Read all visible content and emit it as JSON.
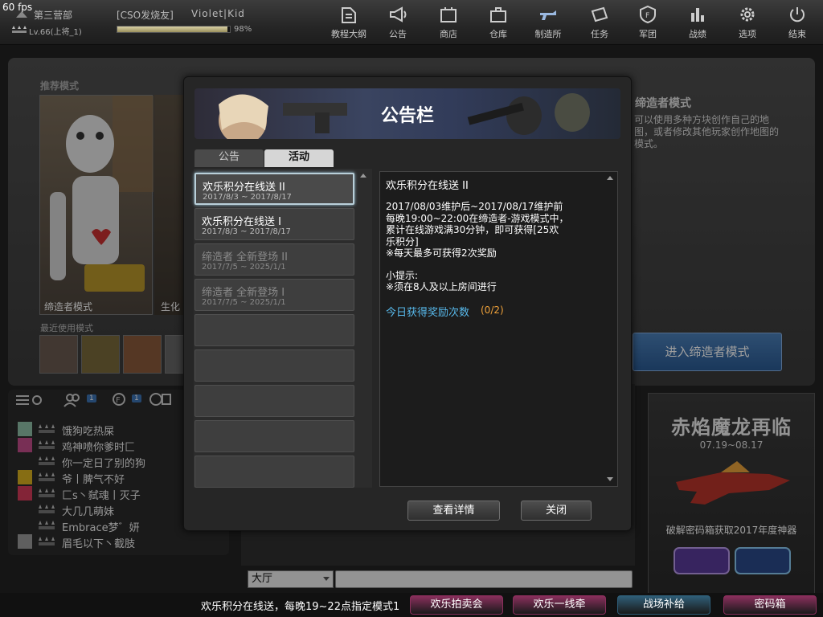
{
  "fps": "60 fps",
  "player": {
    "clan": "第三营部",
    "clan_tag": "[CSO发烧友]",
    "name": "Violet|Kid",
    "level": "Lv.66(上将_1)",
    "exp_percent": "98%",
    "exp_fraction": 0.98
  },
  "nav": [
    {
      "label": "教程大纲",
      "icon": "book-icon"
    },
    {
      "label": "公告",
      "icon": "megaphone-icon"
    },
    {
      "label": "商店",
      "icon": "shop-icon"
    },
    {
      "label": "仓库",
      "icon": "briefcase-icon"
    },
    {
      "label": "制造所",
      "icon": "gun-icon"
    },
    {
      "label": "任务",
      "icon": "ticket-icon"
    },
    {
      "label": "军团",
      "icon": "shield-icon"
    },
    {
      "label": "战绩",
      "icon": "bar-chart-icon"
    },
    {
      "label": "选项",
      "icon": "gear-icon"
    },
    {
      "label": "结束",
      "icon": "power-icon"
    }
  ],
  "lobby": {
    "recommended_title": "推荐模式",
    "mode1_label": "缔造者模式",
    "mode2_label": "生化",
    "recent_title": "最近使用模式",
    "creator_title": "缔造者模式",
    "creator_desc": "可以使用多种方块创作自己的地图，或者修改其他玩家创作地图的模式。",
    "enter_button": "进入缔造者模式"
  },
  "friends": {
    "tab_badges": [
      "1",
      "1"
    ],
    "list": [
      {
        "name": "饿狗吃热屎",
        "avatar_color": "#8fbfa6"
      },
      {
        "name": "鸡神喷你爹时匚",
        "avatar_color": "#c24c8a"
      },
      {
        "name": "你一定日了别的狗",
        "avatar_color": ""
      },
      {
        "name": "爷丨脾气不好",
        "avatar_color": "#d8b020"
      },
      {
        "name": "匚s丶弑魂丨灭子",
        "avatar_color": "#d33a5a"
      },
      {
        "name": "大几几萌妹",
        "avatar_color": ""
      },
      {
        "name": "Embrace梦゛妍",
        "avatar_color": ""
      },
      {
        "name": "眉毛以下丶截肢",
        "avatar_color": "#999999"
      }
    ]
  },
  "chat": {
    "channel": "大厅",
    "input_value": ""
  },
  "promo": {
    "title": "赤焰魔龙再临",
    "date": "07.19~08.17",
    "caption": "破解密码箱获取2017年度神器"
  },
  "bottom": {
    "ticker": "欢乐积分在线送，每晚19~22点指定模式1",
    "buttons": [
      {
        "label": "欢乐拍卖会",
        "color": "#8a2f5c"
      },
      {
        "label": "欢乐一线牵",
        "color": "#8a2f5c"
      },
      {
        "label": "战场补给",
        "color": "#2f5e78"
      },
      {
        "label": "密码箱",
        "color": "#8a2f5c"
      }
    ]
  },
  "modal": {
    "title": "公告栏",
    "tabs": [
      "公告",
      "活动"
    ],
    "active_tab": "活动",
    "items": [
      {
        "title": "欢乐积分在线送 II",
        "date": "2017/8/3 ~ 2017/8/17",
        "state": "selected"
      },
      {
        "title": "欢乐积分在线送 I",
        "date": "2017/8/3 ~ 2017/8/17",
        "state": "normal"
      },
      {
        "title": "缔造者 全新登场 II",
        "date": "2017/7/5 ~ 2025/1/1",
        "state": "disabled"
      },
      {
        "title": "缔造者 全新登场 I",
        "date": "2017/7/5 ~ 2025/1/1",
        "state": "disabled"
      }
    ],
    "content": {
      "title": "欢乐积分在线送 II",
      "body": "2017/08/03维护后~2017/08/17维护前\n每晚19:00~22:00在缔造者-游戏模式中，\n累计在线游戏满30分钟，即可获得[25欢\n乐积分]\n※每天最多可获得2次奖励",
      "tip_heading": "小提示:",
      "tip": "※须在8人及以上房间进行",
      "count_label": "今日获得奖励次数",
      "count_value": "(0/2)"
    },
    "details_button": "查看详情",
    "close_button": "关闭"
  },
  "colors": {
    "accent_blue": "#57b8ea",
    "count_orange": "#f0a23a",
    "enter_button": "#2a5a93"
  }
}
